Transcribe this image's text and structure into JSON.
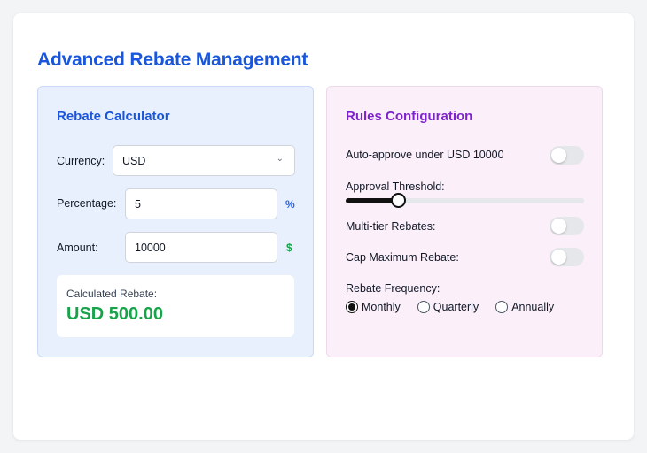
{
  "title": "Advanced Rebate Management",
  "calculator": {
    "title": "Rebate Calculator",
    "currency_label": "Currency:",
    "currency_value": "USD",
    "percentage_label": "Percentage:",
    "percentage_value": "5",
    "percentage_suffix": "%",
    "amount_label": "Amount:",
    "amount_value": "10000",
    "amount_suffix": "$",
    "result_label": "Calculated Rebate:",
    "result_value": "USD 500.00"
  },
  "rules": {
    "title": "Rules Configuration",
    "auto_approve_label": "Auto-approve under USD 10000",
    "auto_approve_on": false,
    "threshold_label": "Approval Threshold:",
    "threshold_fraction": 0.22,
    "multi_tier_label": "Multi-tier Rebates:",
    "multi_tier_on": false,
    "cap_label": "Cap Maximum Rebate:",
    "cap_on": false,
    "frequency_label": "Rebate Frequency:",
    "frequency_options": [
      "Monthly",
      "Quarterly",
      "Annually"
    ],
    "frequency_selected": "Monthly"
  },
  "colors": {
    "accent_blue": "#1a56db",
    "accent_purple": "#7e22ce",
    "success_green": "#16a34a",
    "percent_suffix": "#2563eb",
    "dollar_suffix": "#16a34a"
  }
}
